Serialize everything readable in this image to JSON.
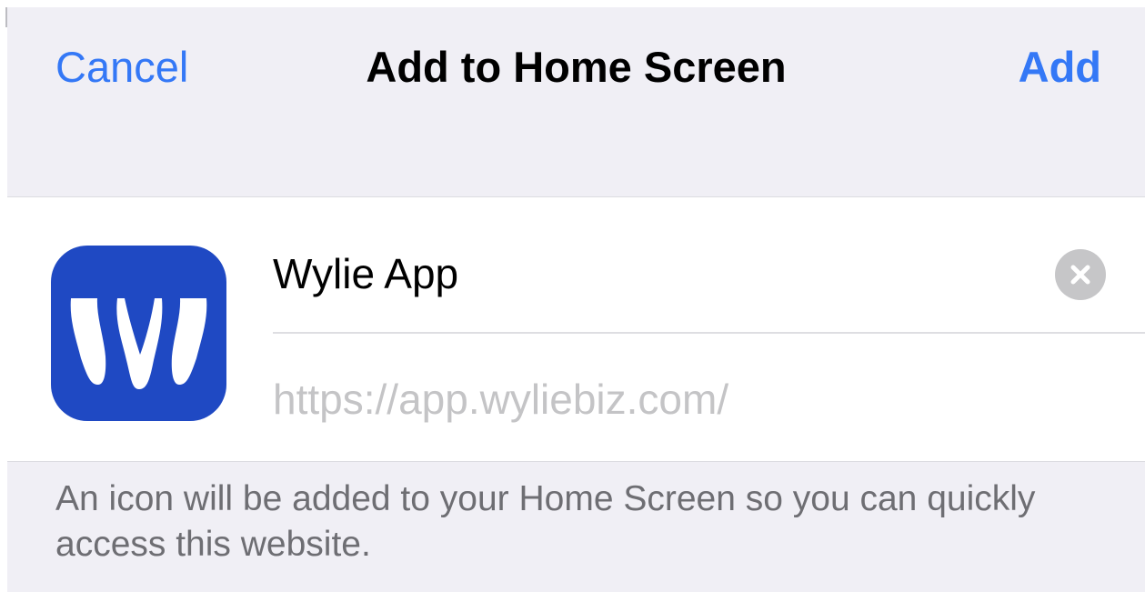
{
  "navbar": {
    "cancel_label": "Cancel",
    "title": "Add to Home Screen",
    "add_label": "Add"
  },
  "bookmark": {
    "icon": "wylie-app-logo",
    "name_value": "Wylie App",
    "url": "https://app.wyliebiz.com/",
    "clear_icon": "clear-circle-x-icon"
  },
  "footer": {
    "note": "An icon will be added to your Home Screen so you can quickly access this website."
  },
  "colors": {
    "accent": "#3478f6",
    "app_icon_background": "#1f49c3",
    "sheet_background": "#f0eff5"
  }
}
